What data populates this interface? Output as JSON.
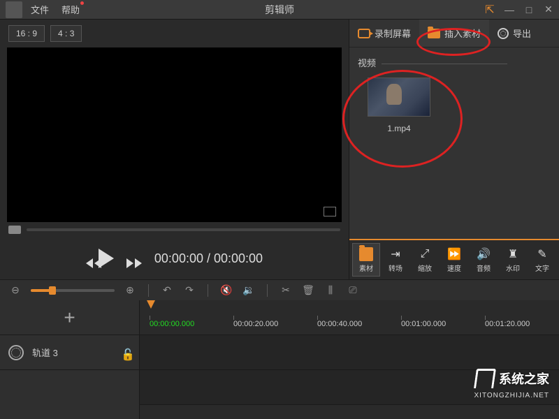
{
  "titlebar": {
    "file": "文件",
    "help": "帮助",
    "app_title": "剪辑师"
  },
  "aspect": {
    "r169": "16 : 9",
    "r43": "4 : 3"
  },
  "playback": {
    "current": "00:00:00",
    "total": "00:00:00",
    "sep": " / "
  },
  "top_tabs": {
    "record": "录制屏幕",
    "insert": "插入素材",
    "export": "导出"
  },
  "media": {
    "video_section": "视频",
    "items": [
      {
        "label": "1.mp4"
      }
    ]
  },
  "tool_tabs": {
    "material": "素材",
    "transition": "转场",
    "scale": "缩放",
    "speed": "速度",
    "audio": "音频",
    "watermark": "水印",
    "text": "文字"
  },
  "timeline": {
    "add": "+",
    "track_name": "轨道 3",
    "ticks": [
      "00:00:00.000",
      "00:00:20.000",
      "00:00:40.000",
      "00:01:00.000",
      "00:01:20.000"
    ]
  },
  "watermark_logo": {
    "title": "系统之家",
    "sub": "XITONGZHIJIA.NET"
  }
}
